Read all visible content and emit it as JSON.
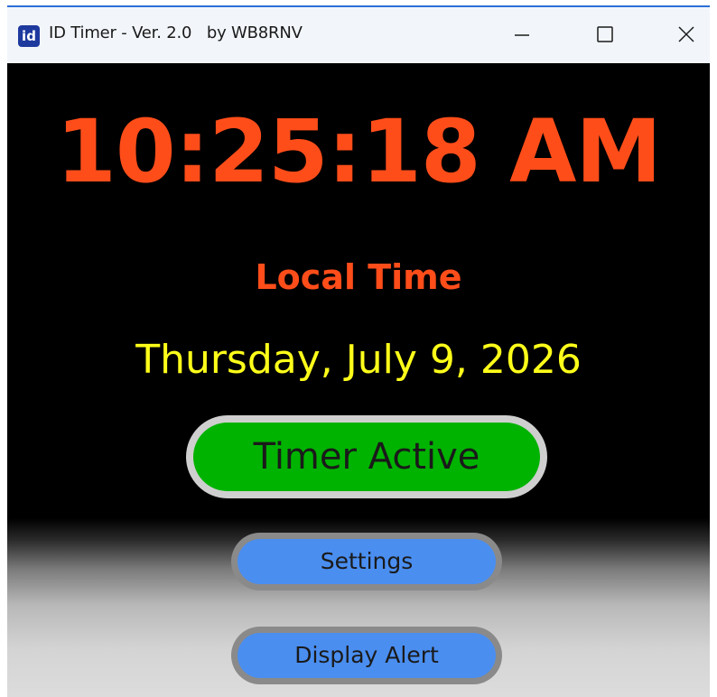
{
  "window": {
    "app_icon_text": "id",
    "title": "ID Timer - Ver. 2.0   by WB8RNV",
    "controls": [
      "minimize-icon",
      "maximize-icon",
      "close-icon"
    ]
  },
  "clock": {
    "time": "10:25:18 AM",
    "label": "Local Time",
    "date": "Thursday, July 9, 2026"
  },
  "status": {
    "label": "Timer Active"
  },
  "buttons": {
    "settings_label": "Settings",
    "alert_label": "Display Alert"
  },
  "colors": {
    "clock": "#ff4d1a",
    "date": "#ffff1a",
    "status_active": "#00b300",
    "button": "#4a8ef0",
    "background": "#000000"
  }
}
